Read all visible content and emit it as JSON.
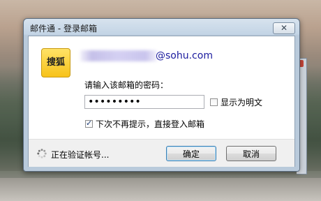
{
  "window": {
    "title": "邮件通 - 登录邮箱",
    "close_icon": "close-icon",
    "close_glyph": "✕"
  },
  "account": {
    "logo_text": "搜狐",
    "email_domain": "@sohu.com"
  },
  "form": {
    "prompt": "请输入该邮箱的密码：",
    "password_value": "•••••••••",
    "show_plain_label": "显示为明文",
    "show_plain_checked": false,
    "remember_label": "下次不再提示，直接登入邮箱",
    "remember_checked": true
  },
  "footer": {
    "status_text": "正在验证帐号...",
    "ok_label": "确定",
    "cancel_label": "取消"
  },
  "colors": {
    "domain_text": "#1b1b9e",
    "logo_bg": "#f7c21a"
  }
}
